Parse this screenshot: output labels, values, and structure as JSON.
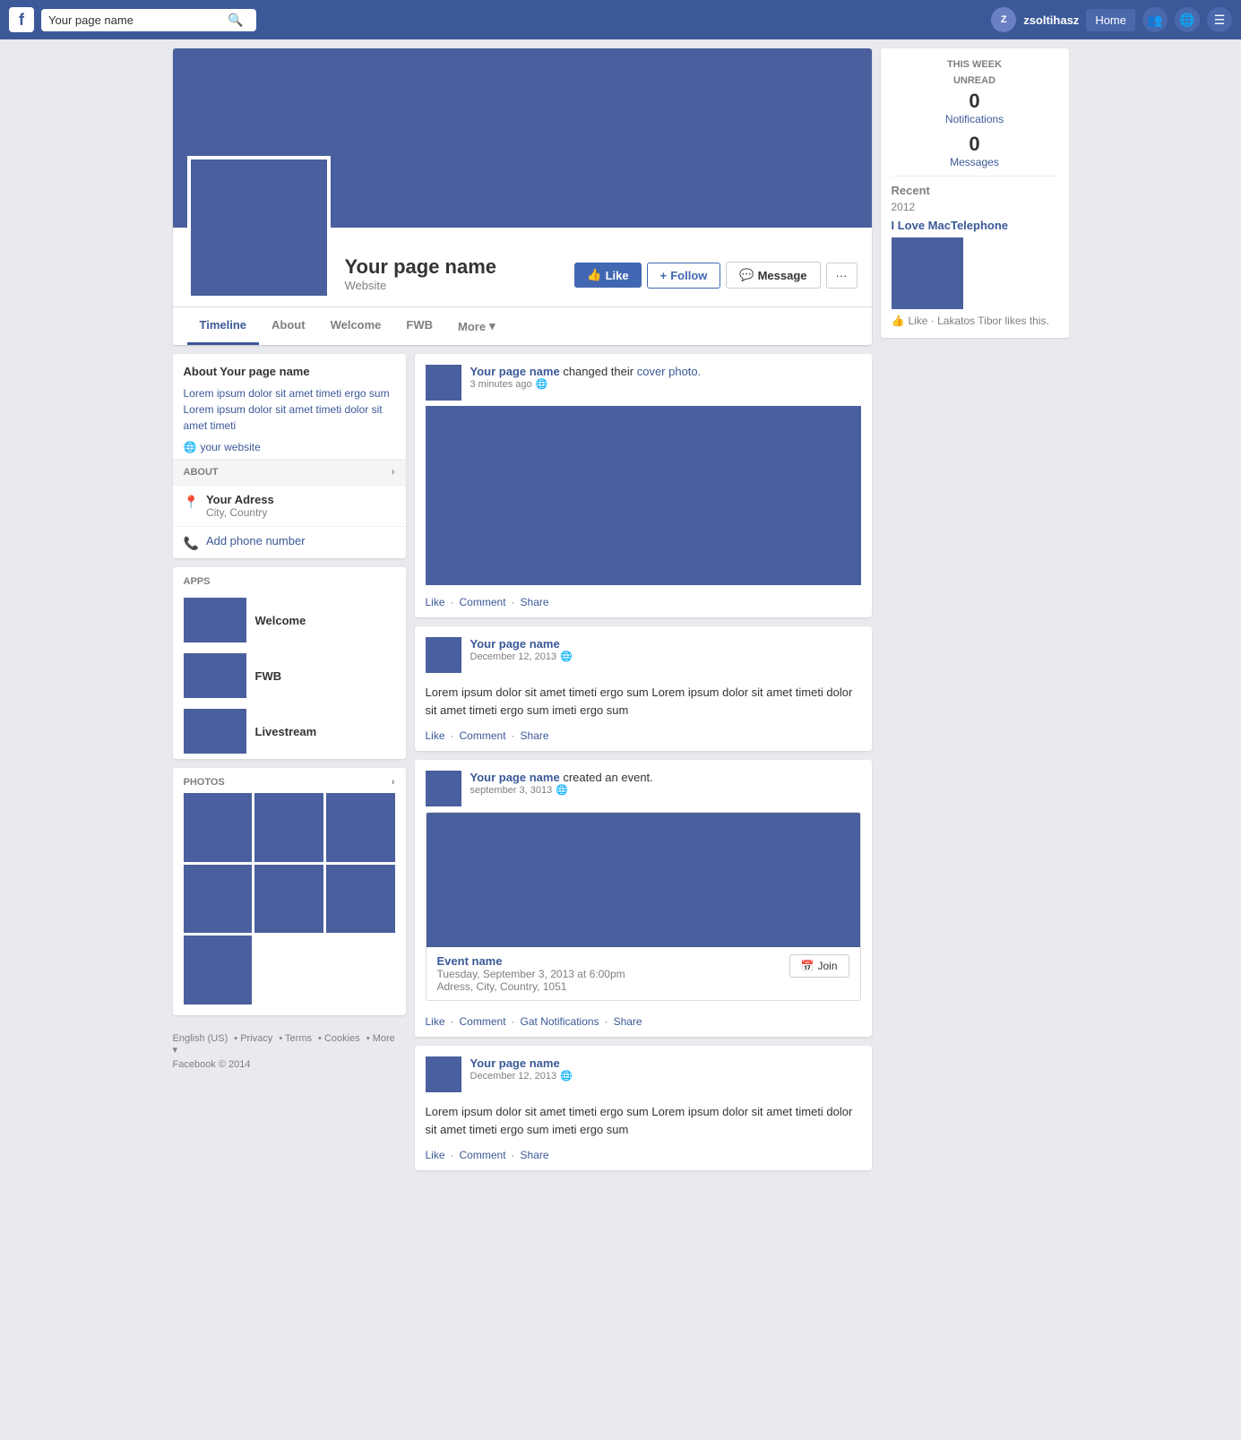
{
  "topnav": {
    "logo": "f",
    "search_placeholder": "Your page name",
    "username": "zsoltihasz",
    "home_label": "Home",
    "search_icon": "🔍"
  },
  "notifications": {
    "week_label": "THIS WEEK",
    "unread_label": "UNREAD",
    "notif_count": "0",
    "notif_link": "Notifications",
    "msg_count": "0",
    "msg_link": "Messages"
  },
  "recent": {
    "label": "Recent",
    "year": "2012",
    "page_name": "I Love MacTelephone",
    "like_text": "Like · Lakatos Tibor likes this."
  },
  "profile": {
    "name": "Your page name",
    "website": "Website",
    "like_btn": "Like",
    "follow_btn": "Follow",
    "message_btn": "Message",
    "more_btn": "···"
  },
  "tabs": {
    "timeline": "Timeline",
    "about": "About",
    "welcome": "Welcome",
    "fwb": "FWB",
    "more": "More"
  },
  "sidebar": {
    "about_title": "About Your page name",
    "about_text": "Lorem ipsum dolor sit amet timeti ergo sum Lorem ipsum dolor sit amet timeti dolor sit amet timeti",
    "website_icon": "🌐",
    "website_text": "your website",
    "about_section": "ABOUT",
    "address_icon": "📍",
    "address_name": "Your Adress",
    "address_city": "City, Country",
    "phone_icon": "📞",
    "phone_text": "Add phone number",
    "apps_label": "APPS",
    "apps": [
      {
        "name": "Welcome"
      },
      {
        "name": "FWB"
      },
      {
        "name": "Livestream"
      }
    ],
    "photos_label": "PHOTOS",
    "photos_count": 7
  },
  "feed": {
    "posts": [
      {
        "id": 1,
        "page_name": "Your page name",
        "action": "changed their",
        "link_text": "cover photo.",
        "time": "3 minutes ago",
        "has_image": true,
        "body": "",
        "actions": [
          "Like",
          "Comment",
          "Share"
        ],
        "type": "cover"
      },
      {
        "id": 2,
        "page_name": "Your page name",
        "action": "",
        "link_text": "",
        "time": "December 12, 2013",
        "has_image": false,
        "body": "Lorem ipsum dolor sit amet timeti ergo sum Lorem ipsum dolor sit amet timeti dolor sit amet timeti ergo sum imeti ergo sum",
        "actions": [
          "Like",
          "Comment",
          "Share"
        ],
        "type": "text"
      },
      {
        "id": 3,
        "page_name": "Your page name",
        "action": "created an event.",
        "link_text": "",
        "time": "september 3, 3013",
        "has_image": true,
        "body": "",
        "event_name": "Event name",
        "event_date": "Tuesday, September 3, 2013 at 6:00pm",
        "event_addr": "Adress, City, Country, 1051",
        "join_btn": "Join",
        "actions": [
          "Like",
          "Comment",
          "Gat Notifications",
          "Share"
        ],
        "type": "event"
      },
      {
        "id": 4,
        "page_name": "Your page name",
        "action": "",
        "link_text": "",
        "time": "December 12, 2013",
        "has_image": false,
        "body": "Lorem ipsum dolor sit amet timeti ergo sum Lorem ipsum dolor sit amet timeti dolor sit amet timeti ergo sum imeti ergo sum",
        "actions": [
          "Like",
          "Comment",
          "Share"
        ],
        "type": "text"
      }
    ]
  },
  "footer": {
    "links": [
      "English (US)",
      "Privacy",
      "Terms",
      "Cookies",
      "More"
    ],
    "copyright": "Facebook © 2014"
  }
}
